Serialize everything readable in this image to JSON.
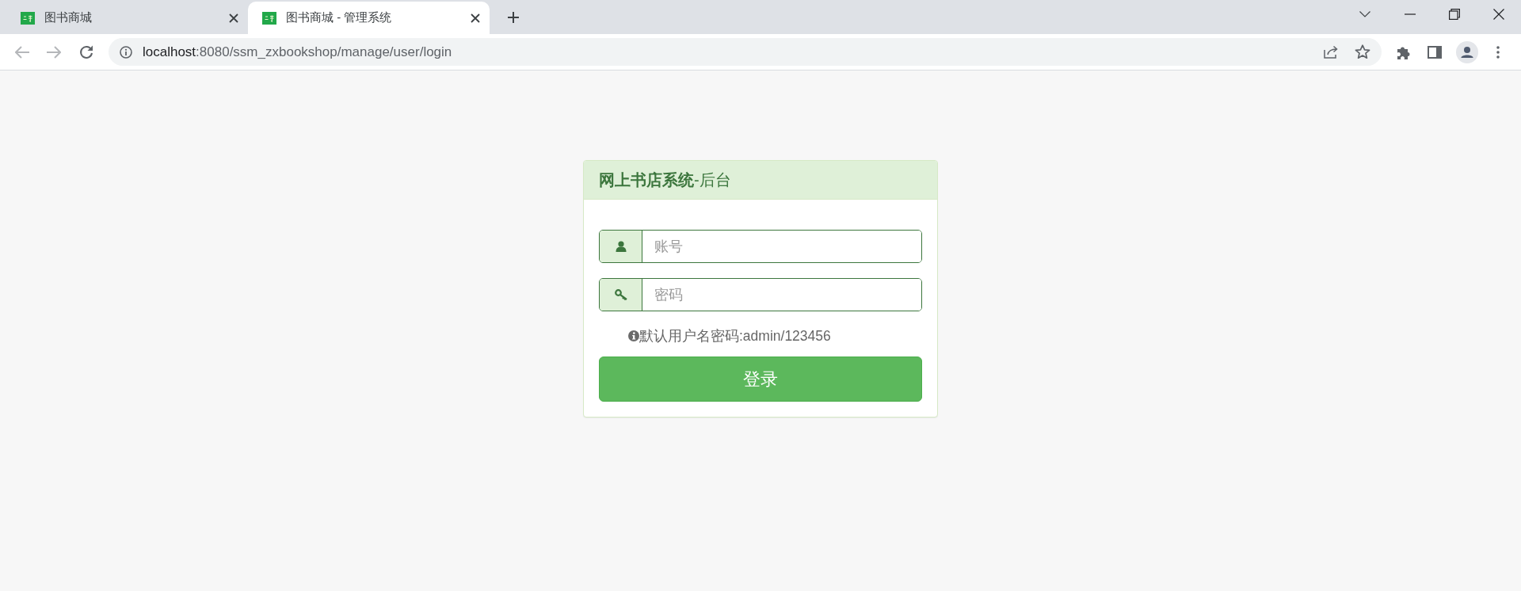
{
  "browser": {
    "tabs": [
      {
        "title": "图书商城",
        "selected": false
      },
      {
        "title": "图书商城 - 管理系统",
        "selected": true
      }
    ],
    "address_bar": {
      "host": "localhost",
      "path": ":8080/ssm_zxbookshop/manage/user/login"
    }
  },
  "login_card": {
    "title": "**网上书店系统**-后台",
    "fields": [
      {
        "kind": "user",
        "placeholder": "账号"
      },
      {
        "kind": "password",
        "placeholder": "密码"
      }
    ],
    "hint": "默认用户名密码:admin/123456",
    "submit": "登录"
  }
}
